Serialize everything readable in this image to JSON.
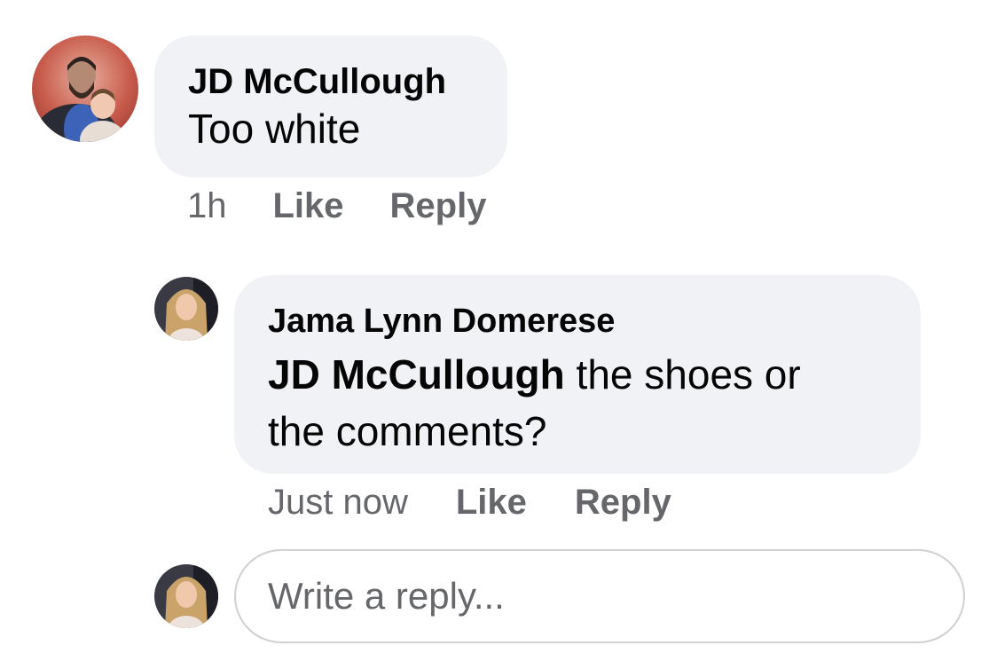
{
  "comment": {
    "author": "JD McCullough",
    "text": "Too white",
    "time": "1h",
    "like_label": "Like",
    "reply_label": "Reply"
  },
  "reply": {
    "author": "Jama Lynn Domerese",
    "mention": "JD McCullough",
    "text_line1_rest": " the shoes or",
    "text_line2": "the comments?",
    "time": "Just now",
    "like_label": "Like",
    "reply_label": "Reply"
  },
  "composer": {
    "placeholder": "Write a reply..."
  },
  "colors": {
    "bubble": "#f0f2f5",
    "meta_text": "#65676b",
    "primary_text": "#050505",
    "input_border": "#ced0d4"
  }
}
